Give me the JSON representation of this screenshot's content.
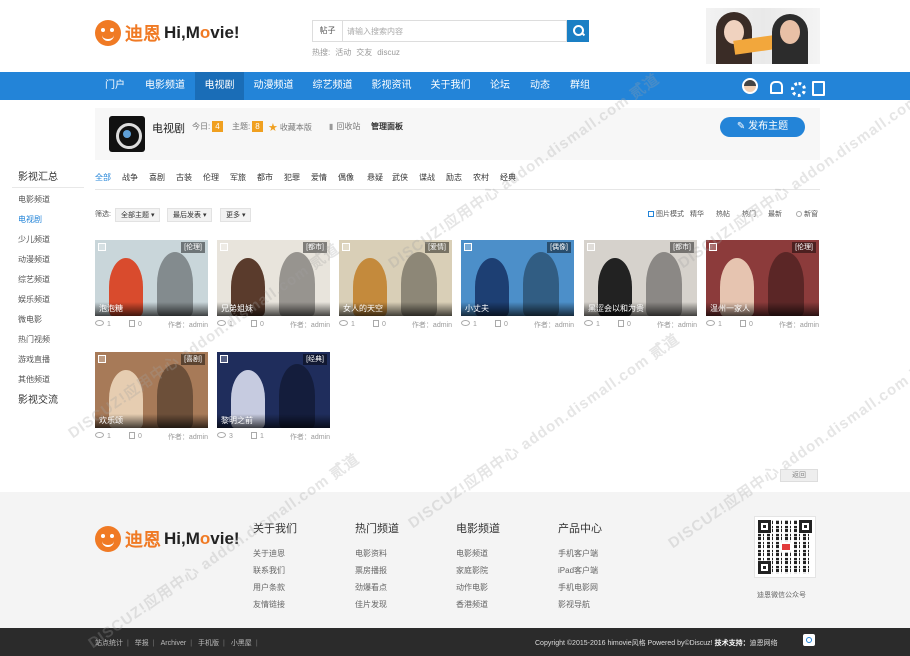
{
  "header": {
    "logo_cn": "迪恩",
    "logo_en_prefix": "Hi,M",
    "logo_en_o": "o",
    "logo_en_suffix": "vie!",
    "search_type": "帖子",
    "search_placeholder": "请输入搜索内容",
    "hot_label": "热搜:",
    "hot_words": [
      "活动",
      "交友",
      "discuz"
    ]
  },
  "nav": {
    "items": [
      "门户",
      "电影频道",
      "电视剧",
      "动漫频道",
      "综艺频道",
      "影视资讯",
      "关于我们",
      "论坛",
      "动态",
      "群组"
    ],
    "active_index": 2
  },
  "sidebar": {
    "head": "影视汇总",
    "items": [
      "电影频道",
      "电视剧",
      "少儿频道",
      "动漫频道",
      "综艺频道",
      "娱乐频道",
      "微电影",
      "热门视频",
      "游戏直播",
      "其他频道"
    ],
    "active_index": 1,
    "foot": "影视交流"
  },
  "forum": {
    "name": "电视剧",
    "today_label": "今日:",
    "today_count": "4",
    "topic_label": "主题:",
    "topic_count": "8",
    "fav_label": "收藏本版",
    "recycle_label": "回收站",
    "admin_label": "管理面板",
    "post_button": "发布主题"
  },
  "categories": [
    "全部",
    "战争",
    "喜剧",
    "古装",
    "伦理",
    "军旅",
    "都市",
    "犯罪",
    "爱情",
    "偶像",
    "悬疑",
    "武侠",
    "谍战",
    "励志",
    "农村",
    "经典"
  ],
  "filter": {
    "label": "筛选:",
    "dropdowns": [
      "全部主题",
      "最后发表",
      "更多"
    ],
    "image_mode": "图片模式",
    "sort_options": [
      "精华",
      "热帖",
      "热门",
      "最新"
    ],
    "new_window": "新窗"
  },
  "cards": [
    {
      "title": "泡泡糖",
      "tag": "[伦理]",
      "views": "1",
      "replies": "0",
      "author": "作者：admin",
      "bg": "#c9d6da",
      "accent": "#d94b2d"
    },
    {
      "title": "兄弟姐妹",
      "tag": "[都市]",
      "views": "1",
      "replies": "0",
      "author": "作者：admin",
      "bg": "#e8e4dc",
      "accent": "#5a3b2c"
    },
    {
      "title": "女人的天空",
      "tag": "[爱情]",
      "views": "1",
      "replies": "0",
      "author": "作者：admin",
      "bg": "#d9cfb7",
      "accent": "#c48a3c"
    },
    {
      "title": "小丈夫",
      "tag": "[偶像]",
      "views": "1",
      "replies": "0",
      "author": "作者：admin",
      "bg": "#4c8fc9",
      "accent": "#1d3f73"
    },
    {
      "title": "黑涩会以和为贵",
      "tag": "[都市]",
      "views": "1",
      "replies": "0",
      "author": "作者：admin",
      "bg": "#d6d2cc",
      "accent": "#222222"
    },
    {
      "title": "温州一家人",
      "tag": "[伦理]",
      "views": "1",
      "replies": "0",
      "author": "作者：admin",
      "bg": "#8c3b3b",
      "accent": "#e6c4b0"
    },
    {
      "title": "欢乐颂",
      "tag": "[喜剧]",
      "views": "1",
      "replies": "0",
      "author": "作者：admin",
      "bg": "#a77a58",
      "accent": "#e6cdb1"
    },
    {
      "title": "黎明之前",
      "tag": "[经典]",
      "views": "3",
      "replies": "1",
      "author": "作者：admin",
      "bg": "#1f2d5c",
      "accent": "#c6cbe0"
    }
  ],
  "back_button": "返回",
  "footer": {
    "columns": [
      {
        "head": "关于我们",
        "items": [
          "关于迪恩",
          "联系我们",
          "用户条款",
          "友情链接"
        ]
      },
      {
        "head": "热门频道",
        "items": [
          "电影资料",
          "票房播报",
          "劲爆看点",
          "佳片发现"
        ]
      },
      {
        "head": "电影频道",
        "items": [
          "电影频道",
          "家庭影院",
          "动作电影",
          "香港频道"
        ]
      },
      {
        "head": "产品中心",
        "items": [
          "手机客户端",
          "iPad客户端",
          "手机电影网",
          "影视导航"
        ]
      }
    ],
    "qr_label": "迪恩微信公众号"
  },
  "bottombar": {
    "links": [
      "站点统计",
      "举报",
      "Archiver",
      "手机版",
      "小黑屋"
    ],
    "copyright": "Copyright  ©2015-2016  himovie风格  Powered by©Discuz!  ",
    "tech_label": "技术支持：",
    "tech_name": "迪恩网络"
  },
  "watermark": "DISCUZ!应用中心 addon.dismall.com 贰道"
}
